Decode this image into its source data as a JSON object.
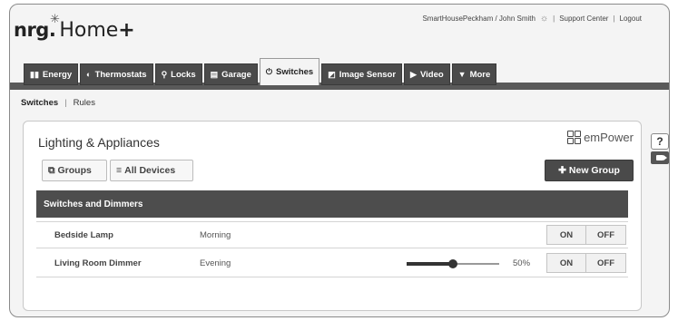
{
  "header": {
    "logo_brand": "nrg.",
    "logo_product": "Home",
    "logo_plus": "+",
    "account": "SmartHousePeckham / John Smith",
    "support": "Support Center",
    "logout": "Logout"
  },
  "tabs": [
    {
      "label": "Energy",
      "icon": "chart-icon",
      "glyph": "▮▮"
    },
    {
      "label": "Thermostats",
      "icon": "thermostat-icon",
      "glyph": "◐"
    },
    {
      "label": "Locks",
      "icon": "key-icon",
      "glyph": "⚲"
    },
    {
      "label": "Garage",
      "icon": "garage-icon",
      "glyph": "▤"
    },
    {
      "label": "Switches",
      "icon": "power-icon",
      "glyph": "⏻",
      "active": true
    },
    {
      "label": "Image Sensor",
      "icon": "camera-icon",
      "glyph": "◩"
    },
    {
      "label": "Video",
      "icon": "video-icon",
      "glyph": "▶"
    },
    {
      "label": "More",
      "icon": "caret-down-icon",
      "glyph": "▼"
    }
  ],
  "subnav": {
    "current": "Switches",
    "rules": "Rules"
  },
  "panel": {
    "title": "Lighting & Appliances",
    "brand": "emPower",
    "groups_label": "Groups",
    "all_devices_label": "All Devices",
    "new_group_label": "New Group",
    "section_title": "Switches and Dimmers"
  },
  "devices": [
    {
      "name": "Bedside Lamp",
      "schedule": "Morning",
      "on_label": "ON",
      "off_label": "OFF"
    },
    {
      "name": "Living Room Dimmer",
      "schedule": "Evening",
      "level": 50,
      "level_text": "50%",
      "on_label": "ON",
      "off_label": "OFF"
    }
  ],
  "side": {
    "help": "?"
  }
}
